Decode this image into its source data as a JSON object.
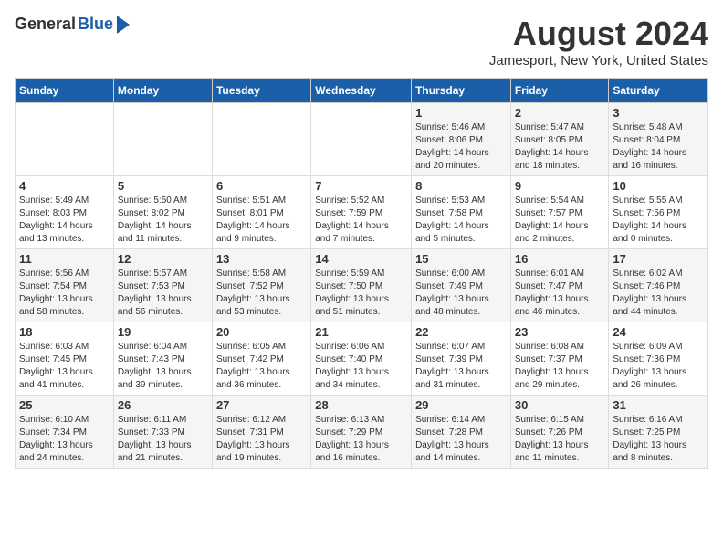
{
  "header": {
    "logo_general": "General",
    "logo_blue": "Blue",
    "title": "August 2024",
    "subtitle": "Jamesport, New York, United States"
  },
  "weekdays": [
    "Sunday",
    "Monday",
    "Tuesday",
    "Wednesday",
    "Thursday",
    "Friday",
    "Saturday"
  ],
  "weeks": [
    [
      {
        "day": "",
        "details": ""
      },
      {
        "day": "",
        "details": ""
      },
      {
        "day": "",
        "details": ""
      },
      {
        "day": "",
        "details": ""
      },
      {
        "day": "1",
        "details": "Sunrise: 5:46 AM\nSunset: 8:06 PM\nDaylight: 14 hours\nand 20 minutes."
      },
      {
        "day": "2",
        "details": "Sunrise: 5:47 AM\nSunset: 8:05 PM\nDaylight: 14 hours\nand 18 minutes."
      },
      {
        "day": "3",
        "details": "Sunrise: 5:48 AM\nSunset: 8:04 PM\nDaylight: 14 hours\nand 16 minutes."
      }
    ],
    [
      {
        "day": "4",
        "details": "Sunrise: 5:49 AM\nSunset: 8:03 PM\nDaylight: 14 hours\nand 13 minutes."
      },
      {
        "day": "5",
        "details": "Sunrise: 5:50 AM\nSunset: 8:02 PM\nDaylight: 14 hours\nand 11 minutes."
      },
      {
        "day": "6",
        "details": "Sunrise: 5:51 AM\nSunset: 8:01 PM\nDaylight: 14 hours\nand 9 minutes."
      },
      {
        "day": "7",
        "details": "Sunrise: 5:52 AM\nSunset: 7:59 PM\nDaylight: 14 hours\nand 7 minutes."
      },
      {
        "day": "8",
        "details": "Sunrise: 5:53 AM\nSunset: 7:58 PM\nDaylight: 14 hours\nand 5 minutes."
      },
      {
        "day": "9",
        "details": "Sunrise: 5:54 AM\nSunset: 7:57 PM\nDaylight: 14 hours\nand 2 minutes."
      },
      {
        "day": "10",
        "details": "Sunrise: 5:55 AM\nSunset: 7:56 PM\nDaylight: 14 hours\nand 0 minutes."
      }
    ],
    [
      {
        "day": "11",
        "details": "Sunrise: 5:56 AM\nSunset: 7:54 PM\nDaylight: 13 hours\nand 58 minutes."
      },
      {
        "day": "12",
        "details": "Sunrise: 5:57 AM\nSunset: 7:53 PM\nDaylight: 13 hours\nand 56 minutes."
      },
      {
        "day": "13",
        "details": "Sunrise: 5:58 AM\nSunset: 7:52 PM\nDaylight: 13 hours\nand 53 minutes."
      },
      {
        "day": "14",
        "details": "Sunrise: 5:59 AM\nSunset: 7:50 PM\nDaylight: 13 hours\nand 51 minutes."
      },
      {
        "day": "15",
        "details": "Sunrise: 6:00 AM\nSunset: 7:49 PM\nDaylight: 13 hours\nand 48 minutes."
      },
      {
        "day": "16",
        "details": "Sunrise: 6:01 AM\nSunset: 7:47 PM\nDaylight: 13 hours\nand 46 minutes."
      },
      {
        "day": "17",
        "details": "Sunrise: 6:02 AM\nSunset: 7:46 PM\nDaylight: 13 hours\nand 44 minutes."
      }
    ],
    [
      {
        "day": "18",
        "details": "Sunrise: 6:03 AM\nSunset: 7:45 PM\nDaylight: 13 hours\nand 41 minutes."
      },
      {
        "day": "19",
        "details": "Sunrise: 6:04 AM\nSunset: 7:43 PM\nDaylight: 13 hours\nand 39 minutes."
      },
      {
        "day": "20",
        "details": "Sunrise: 6:05 AM\nSunset: 7:42 PM\nDaylight: 13 hours\nand 36 minutes."
      },
      {
        "day": "21",
        "details": "Sunrise: 6:06 AM\nSunset: 7:40 PM\nDaylight: 13 hours\nand 34 minutes."
      },
      {
        "day": "22",
        "details": "Sunrise: 6:07 AM\nSunset: 7:39 PM\nDaylight: 13 hours\nand 31 minutes."
      },
      {
        "day": "23",
        "details": "Sunrise: 6:08 AM\nSunset: 7:37 PM\nDaylight: 13 hours\nand 29 minutes."
      },
      {
        "day": "24",
        "details": "Sunrise: 6:09 AM\nSunset: 7:36 PM\nDaylight: 13 hours\nand 26 minutes."
      }
    ],
    [
      {
        "day": "25",
        "details": "Sunrise: 6:10 AM\nSunset: 7:34 PM\nDaylight: 13 hours\nand 24 minutes."
      },
      {
        "day": "26",
        "details": "Sunrise: 6:11 AM\nSunset: 7:33 PM\nDaylight: 13 hours\nand 21 minutes."
      },
      {
        "day": "27",
        "details": "Sunrise: 6:12 AM\nSunset: 7:31 PM\nDaylight: 13 hours\nand 19 minutes."
      },
      {
        "day": "28",
        "details": "Sunrise: 6:13 AM\nSunset: 7:29 PM\nDaylight: 13 hours\nand 16 minutes."
      },
      {
        "day": "29",
        "details": "Sunrise: 6:14 AM\nSunset: 7:28 PM\nDaylight: 13 hours\nand 14 minutes."
      },
      {
        "day": "30",
        "details": "Sunrise: 6:15 AM\nSunset: 7:26 PM\nDaylight: 13 hours\nand 11 minutes."
      },
      {
        "day": "31",
        "details": "Sunrise: 6:16 AM\nSunset: 7:25 PM\nDaylight: 13 hours\nand 8 minutes."
      }
    ]
  ]
}
